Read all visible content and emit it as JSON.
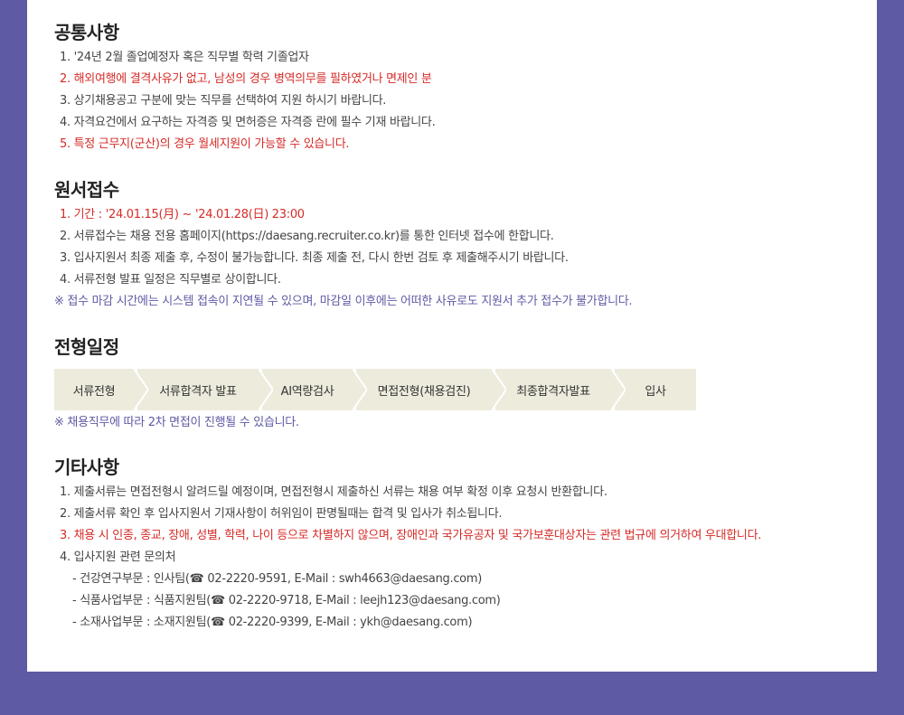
{
  "common": {
    "title": "공통사항",
    "items": [
      {
        "text": "1. '24년 2월 졸업예정자 혹은 직무별 학력 기졸업자",
        "highlight": false
      },
      {
        "text": "2. 해외여행에 결격사유가 없고, 남성의 경우 병역의무를 필하였거나 면제인 분",
        "highlight": true
      },
      {
        "text": "3. 상기채용공고 구분에 맞는 직무를 선택하여 지원 하시기 바랍니다.",
        "highlight": false
      },
      {
        "text": "4. 자격요건에서 요구하는 자격증 및 면허증은 자격증 란에 필수 기재 바랍니다.",
        "highlight": false
      },
      {
        "text": "5. 특정 근무지(군산)의 경우 월세지원이 가능할 수 있습니다.",
        "highlight": true
      }
    ]
  },
  "application": {
    "title": "원서접수",
    "items": [
      {
        "text": "1. 기간 : '24.01.15(月) ~ '24.01.28(日) 23:00",
        "highlight": true
      },
      {
        "text": "2. 서류접수는 채용 전용 홈페이지(https://daesang.recruiter.co.kr)를 통한 인터넷 접수에 한합니다.",
        "highlight": false
      },
      {
        "text": "3. 입사지원서 최종 제출 후, 수정이 불가능합니다. 최종 제출 전, 다시 한번 검토 후 제출해주시기 바랍니다.",
        "highlight": false
      },
      {
        "text": "4. 서류전형 발표 일정은 직무별로 상이합니다.",
        "highlight": false
      }
    ],
    "note": "※ 접수 마감 시간에는 시스템 접속이 지연될 수 있으며, 마감일 이후에는 어떠한 사유로도 지원서 추가 접수가 불가합니다."
  },
  "schedule": {
    "title": "전형일정",
    "steps": [
      "서류전형",
      "서류합격자 발표",
      "AI역량검사",
      "면접전형(채용검진)",
      "최종합격자발표",
      "입사"
    ],
    "note": "※ 채용직무에 따라 2차 면접이 진행될 수 있습니다."
  },
  "other": {
    "title": "기타사항",
    "items": [
      {
        "text": "1. 제출서류는 면접전형시 알려드릴 예정이며, 면접전형시 제출하신 서류는 채용 여부 확정 이후 요청시 반환합니다.",
        "highlight": false
      },
      {
        "text": "2. 제출서류 확인 후 입사지원서 기재사항이 허위임이 판명될때는 합격 및 입사가 취소됩니다.",
        "highlight": false
      },
      {
        "text": "3. 채용 시 인종, 종교, 장애, 성별, 학력, 나이 등으로 차별하지 않으며, 장애인과 국가유공자 및 국가보훈대상자는 관련 법규에 의거하여 우대합니다.",
        "highlight": true
      },
      {
        "text": "4. 입사지원 관련 문의처",
        "highlight": false
      }
    ],
    "contacts": [
      "- 건강연구부문 : 인사팀(☎ 02-2220-9591, E-Mail : swh4663@daesang.com)",
      "- 식품사업부문 : 식품지원팀(☎ 02-2220-9718, E-Mail : leejh123@daesang.com)",
      "- 소재사업부문 : 소재지원팀(☎ 02-2220-9399, E-Mail : ykh@daesang.com)"
    ]
  },
  "colors": {
    "background": "#5e5aa4",
    "highlight": "#d52b27",
    "note": "#5e5aa4",
    "step_fill": "#edebdc"
  }
}
